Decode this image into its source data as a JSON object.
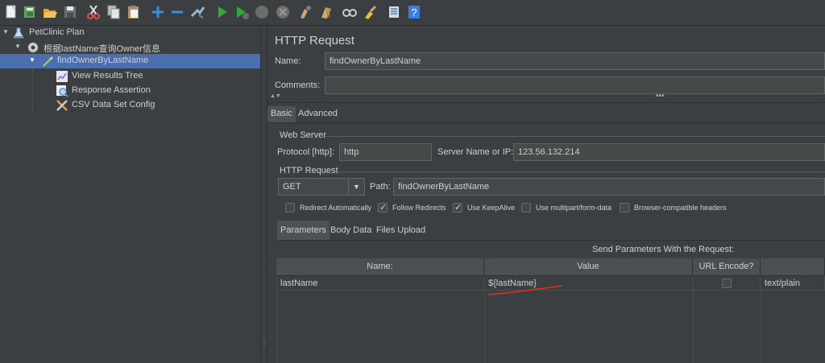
{
  "toolbar": {
    "buttons": [
      {
        "name": "new-icon",
        "color": "#e8e8e8"
      },
      {
        "name": "templates-icon",
        "color": "#5fa35f"
      },
      {
        "name": "open-icon",
        "color": "#e0a531"
      },
      {
        "name": "save-icon",
        "color": "#9aa0a6"
      },
      {
        "name": "cut-icon",
        "color": "#d9534f"
      },
      {
        "name": "copy-icon",
        "color": "#c9c9c9"
      },
      {
        "name": "paste-icon",
        "color": "#d2a56a"
      },
      {
        "name": "expand-icon",
        "color": "#3a8fde"
      },
      {
        "name": "collapse-icon",
        "color": "#3a8fde"
      },
      {
        "name": "toggle-icon",
        "color": "#8fb8de"
      },
      {
        "name": "start-icon",
        "color": "#2eaa3c"
      },
      {
        "name": "start-no-pauses-icon",
        "color": "#2eaa3c"
      },
      {
        "name": "stop-icon",
        "color": "#7a7a7a"
      },
      {
        "name": "shutdown-icon",
        "color": "#7a7a7a"
      },
      {
        "name": "clear-icon",
        "color": "#d2a56a"
      },
      {
        "name": "clear-all-icon",
        "color": "#d2a56a"
      },
      {
        "name": "search-icon",
        "color": "#cccccc"
      },
      {
        "name": "reset-search-icon",
        "color": "#e6c33a"
      },
      {
        "name": "function-helper-icon",
        "color": "#d0d0d0"
      },
      {
        "name": "help-icon",
        "color": "#3a7fde"
      }
    ]
  },
  "tree": {
    "plan": "PetClinic Plan",
    "thread_group": "根据lastName查询Owner信息",
    "sampler": "findOwnerByLastName",
    "children": [
      "View Results Tree",
      "Response Assertion",
      "CSV Data Set Config"
    ]
  },
  "request": {
    "title": "HTTP Request",
    "name_label": "Name:",
    "name_value": "findOwnerByLastName",
    "comments_label": "Comments:",
    "comments_value": "",
    "tabs": [
      "Basic",
      "Advanced"
    ],
    "web_server": {
      "title": "Web Server",
      "protocol_label": "Protocol [http]:",
      "protocol_value": "http",
      "server_label": "Server Name or IP:",
      "server_value": "123.56.132.214"
    },
    "http_request": {
      "title": "HTTP Request",
      "method": "GET",
      "path_label": "Path:",
      "path_value": "findOwnerByLastName"
    },
    "options": [
      {
        "label": "Redirect Automatically",
        "checked": false
      },
      {
        "label": "Follow Redirects",
        "checked": true
      },
      {
        "label": "Use KeepAlive",
        "checked": true
      },
      {
        "label": "Use multipart/form-data",
        "checked": false
      },
      {
        "label": "Browser-compatible headers",
        "checked": false
      }
    ],
    "param_tabs": [
      "Parameters",
      "Body Data",
      "Files Upload"
    ],
    "send_params_label": "Send Parameters With the Request:",
    "columns": [
      "Name:",
      "Value",
      "URL Encode?",
      ""
    ],
    "rows": [
      {
        "name": "lastName",
        "value": "${lastName}",
        "url_encode": false,
        "content_type": "text/plain"
      }
    ],
    "annotation_color": "#e0301e"
  }
}
